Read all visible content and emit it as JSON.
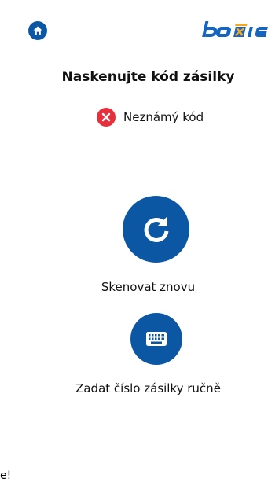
{
  "header": {
    "home_icon": "home-icon",
    "logo_text": "boxie"
  },
  "main": {
    "title": "Naskenujte kód zásilky",
    "status": {
      "icon": "error-x-icon",
      "text": "Neznámý kód",
      "color": "#e8303d"
    },
    "rescan": {
      "icon": "refresh-icon",
      "label": "Skenovat znovu"
    },
    "manual": {
      "icon": "keyboard-icon",
      "label": "Zadat číslo zásilky ručně"
    }
  },
  "stray_text": "e!",
  "colors": {
    "primary": "#0b57a4",
    "logo_accent": "#f5a623"
  }
}
